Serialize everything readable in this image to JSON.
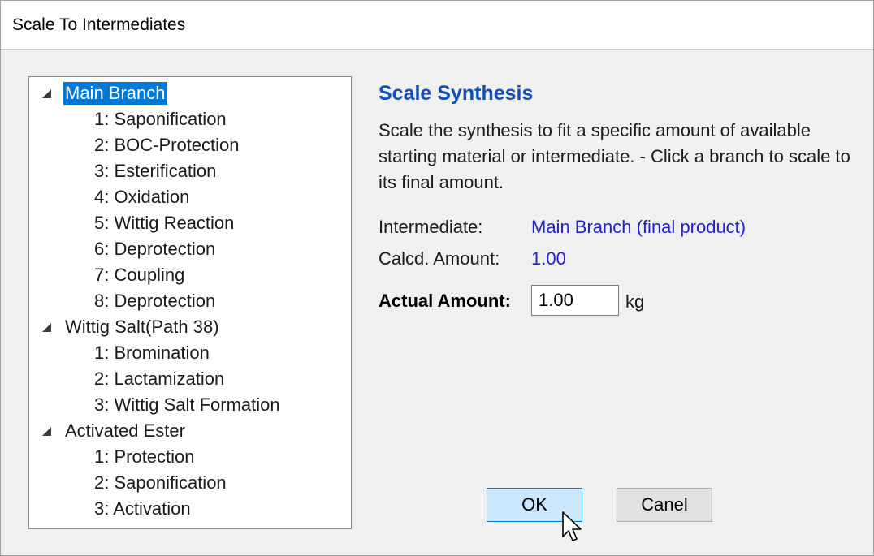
{
  "window": {
    "title": "Scale To Intermediates"
  },
  "tree": {
    "branches": [
      {
        "label": "Main Branch",
        "selected": true,
        "steps": [
          "1: Saponification",
          "2: BOC-Protection",
          "3: Esterification",
          "4: Oxidation",
          "5: Wittig Reaction",
          "6: Deprotection",
          "7: Coupling",
          "8: Deprotection"
        ]
      },
      {
        "label": "Wittig Salt(Path 38)",
        "selected": false,
        "steps": [
          "1: Bromination",
          "2: Lactamization",
          "3: Wittig Salt Formation"
        ]
      },
      {
        "label": "Activated Ester",
        "selected": false,
        "steps": [
          "1: Protection",
          "2: Saponification",
          "3: Activation"
        ]
      }
    ]
  },
  "panel": {
    "title": "Scale Synthesis",
    "description": "Scale the synthesis to fit a specific amount of available starting material or intermediate. - Click a branch to scale to its final amount.",
    "intermediate_label": "Intermediate:",
    "intermediate_value": "Main Branch (final product)",
    "calcd_label": "Calcd. Amount:",
    "calcd_value": "1.00",
    "actual_label": "Actual Amount:",
    "actual_value": "1.00",
    "unit": "kg"
  },
  "buttons": {
    "ok": "OK",
    "cancel": "Canel"
  },
  "icons": {
    "expander": "triangle-expanded-icon",
    "cursor": "mouse-pointer-icon"
  },
  "colors": {
    "selection": "#0078d7",
    "title_accent": "#0f4fb8",
    "value_text": "#2222cc"
  }
}
